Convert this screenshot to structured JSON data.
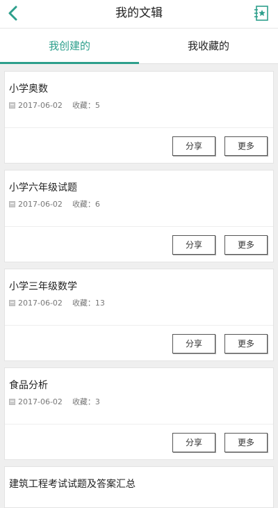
{
  "header": {
    "title": "我的文辑",
    "back_icon": "chevron-left-icon",
    "add_icon": "add-favorite-icon",
    "accent": "#2d9f8c"
  },
  "tabs": [
    {
      "label": "我创建的",
      "active": true
    },
    {
      "label": "我收藏的",
      "active": false
    }
  ],
  "cards": [
    {
      "title": "小学奥数",
      "date": "2017-06-02",
      "favorites": "收藏：5",
      "share_label": "分享",
      "more_label": "更多"
    },
    {
      "title": "小学六年级试题",
      "date": "2017-06-02",
      "favorites": "收藏：6",
      "share_label": "分享",
      "more_label": "更多"
    },
    {
      "title": "小学三年级数学",
      "date": "2017-06-02",
      "favorites": "收藏：13",
      "share_label": "分享",
      "more_label": "更多"
    },
    {
      "title": "食品分析",
      "date": "2017-06-02",
      "favorites": "收藏：3",
      "share_label": "分享",
      "more_label": "更多"
    },
    {
      "title": "建筑工程考试试题及答案汇总"
    }
  ]
}
